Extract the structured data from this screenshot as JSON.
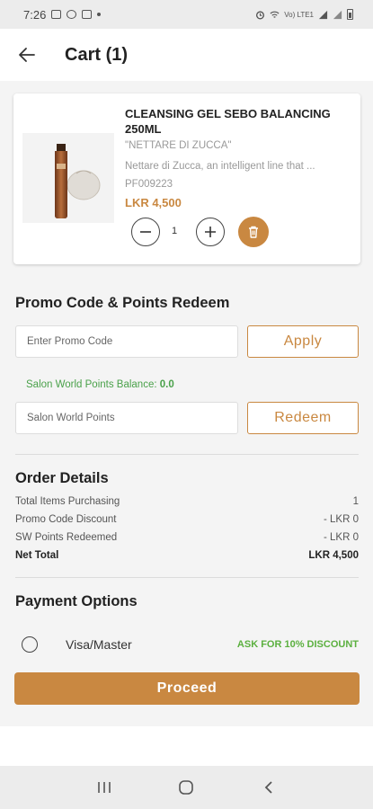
{
  "status_bar": {
    "time": "7:26",
    "network_text": "Vo) LTE1"
  },
  "header": {
    "title": "Cart (1)",
    "back_icon": "arrow-left-icon"
  },
  "cart": {
    "items": [
      {
        "name": "CLEANSING GEL SEBO BALANCING 250ML",
        "subtitle": "\"NETTARE DI ZUCCA\"",
        "description": "Nettare di Zucca, an intelligent line that ...",
        "code": "PF009223",
        "price": "LKR 4,500",
        "quantity": "1"
      }
    ]
  },
  "promo": {
    "title": "Promo Code & Points Redeem",
    "promo_placeholder": "Enter Promo Code",
    "apply_label": "Apply",
    "balance_label": "Salon World Points Balance:",
    "balance_value": "0.0",
    "points_placeholder": "Salon World Points",
    "redeem_label": "Redeem"
  },
  "order_details": {
    "title": "Order Details",
    "rows": [
      {
        "label": "Total Items Purchasing",
        "value": "1"
      },
      {
        "label": "Promo Code Discount",
        "value": "- LKR 0"
      },
      {
        "label": "SW Points Redeemed",
        "value": "- LKR 0"
      },
      {
        "label": "Net Total",
        "value": "LKR 4,500"
      }
    ]
  },
  "payment": {
    "title": "Payment Options",
    "option_label": "Visa/Master",
    "discount_text": "ASK FOR 10% DISCOUNT",
    "proceed_label": "Proceed"
  },
  "colors": {
    "accent": "#c98841",
    "success": "#4aa14a"
  }
}
